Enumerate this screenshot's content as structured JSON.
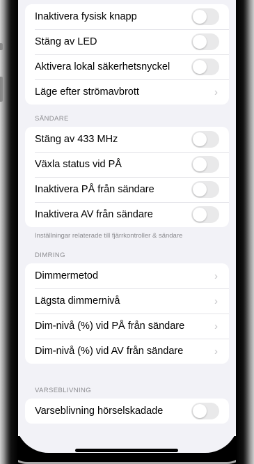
{
  "groups": {
    "top": {
      "rows": [
        {
          "label": "Inaktivera fysisk knapp",
          "control": "toggle"
        },
        {
          "label": "Stäng av LED",
          "control": "toggle"
        },
        {
          "label": "Aktivera lokal säkerhetsnyckel",
          "control": "toggle"
        },
        {
          "label": "Läge efter strömavbrott",
          "control": "chevron"
        }
      ]
    },
    "sandare": {
      "header": "SÄNDARE",
      "rows": [
        {
          "label": "Stäng av 433 MHz",
          "control": "toggle"
        },
        {
          "label": "Växla status vid PÅ",
          "control": "toggle"
        },
        {
          "label": "Inaktivera PÅ från sändare",
          "control": "toggle"
        },
        {
          "label": "Inaktivera AV från sändare",
          "control": "toggle"
        }
      ],
      "footer": "Inställningar relaterade till fjärrkontroller & sändare"
    },
    "dimring": {
      "header": "DIMRING",
      "rows": [
        {
          "label": "Dimmermetod",
          "control": "chevron"
        },
        {
          "label": "Lägsta dimmernivå",
          "control": "chevron"
        },
        {
          "label": "Dim-nivå (%) vid PÅ från sändare",
          "control": "chevron"
        },
        {
          "label": "Dim-nivå (%) vid AV från sändare",
          "control": "chevron"
        }
      ]
    },
    "varseblivning": {
      "header": "VARSEBLIVNING",
      "rows": [
        {
          "label": "Varseblivning hörselskadade",
          "control": "toggle"
        }
      ]
    }
  },
  "toggles_state": "off",
  "chevron_glyph": "›",
  "colors": {
    "background": "#f2f2f7",
    "toggle_off": "#e9e9ea",
    "secondary_text": "#8a8a8e"
  }
}
